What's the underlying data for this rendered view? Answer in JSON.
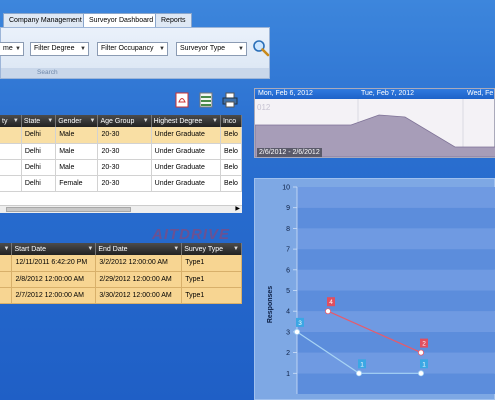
{
  "tabs": [
    {
      "label": "Company Management",
      "active": false
    },
    {
      "label": "Surveyor Dashboard",
      "active": true
    },
    {
      "label": "Reports",
      "active": false
    }
  ],
  "filters": {
    "first": "me",
    "degree": "Filter Degree",
    "occupancy": "Filter Occupancy",
    "surveyor_type": "Surveyor Type",
    "group_label": "Search"
  },
  "toolbar": [
    {
      "icon": "pdf-export-icon"
    },
    {
      "icon": "excel-export-icon"
    },
    {
      "icon": "print-icon"
    }
  ],
  "surveyors_grid": {
    "columns": [
      "ty",
      "State",
      "Gender",
      "Age Group",
      "Highest Degree",
      "Inco"
    ],
    "rows": [
      {
        "city": "",
        "state": "Delhi",
        "gender": "Male",
        "age": "20-30",
        "degree": "Under Graduate",
        "income": "Belo"
      },
      {
        "city": "",
        "state": "Delhi",
        "gender": "Male",
        "age": "20-30",
        "degree": "Under Graduate",
        "income": "Belo"
      },
      {
        "city": "",
        "state": "Delhi",
        "gender": "Male",
        "age": "20-30",
        "degree": "Under Graduate",
        "income": "Belo"
      },
      {
        "city": "",
        "state": "Delhi",
        "gender": "Female",
        "age": "20-30",
        "degree": "Under Graduate",
        "income": "Belo"
      }
    ]
  },
  "surveys_grid": {
    "columns": [
      "",
      "Start Date",
      "End Date",
      "Survey Type"
    ],
    "rows": [
      {
        "first": "",
        "start": "12/11/2011 6:42:20 PM",
        "end": "3/2/2012 12:00:00 AM",
        "type": "Type1"
      },
      {
        "first": "",
        "start": "2/8/2012 12:00:00 AM",
        "end": "2/29/2012 12:00:00 AM",
        "type": "Type1"
      },
      {
        "first": "",
        "start": "2/7/2012 12:00:00 AM",
        "end": "3/30/2012 12:00:00 AM",
        "type": "Type1"
      }
    ]
  },
  "timeline": {
    "dates": [
      "Mon, Feb 6, 2012",
      "Tue, Feb 7, 2012",
      "Wed, Fe"
    ],
    "faded_label": "012",
    "range_label": "2/6/2012 - 2/6/2012"
  },
  "chart_data": {
    "type": "line",
    "ylabel": "Responses",
    "ylim": [
      0,
      10
    ],
    "yticks": [
      1,
      2,
      3,
      4,
      5,
      6,
      7,
      8,
      9,
      10
    ],
    "series": [
      {
        "color": "#a8d4f5",
        "x": [
          0,
          1,
          2
        ],
        "values": [
          3,
          1,
          1
        ],
        "labels": [
          "3",
          "1",
          "1"
        ]
      },
      {
        "color": "#e85a6a",
        "x": [
          0.5,
          2
        ],
        "values": [
          4,
          2
        ],
        "labels": [
          "4",
          "2"
        ]
      }
    ]
  },
  "watermark": "AITDRIVE",
  "colors": {
    "header_blue": "#1d62c8",
    "row_highlight": "#f9dfa4",
    "survey_rows": "#f7d592"
  }
}
